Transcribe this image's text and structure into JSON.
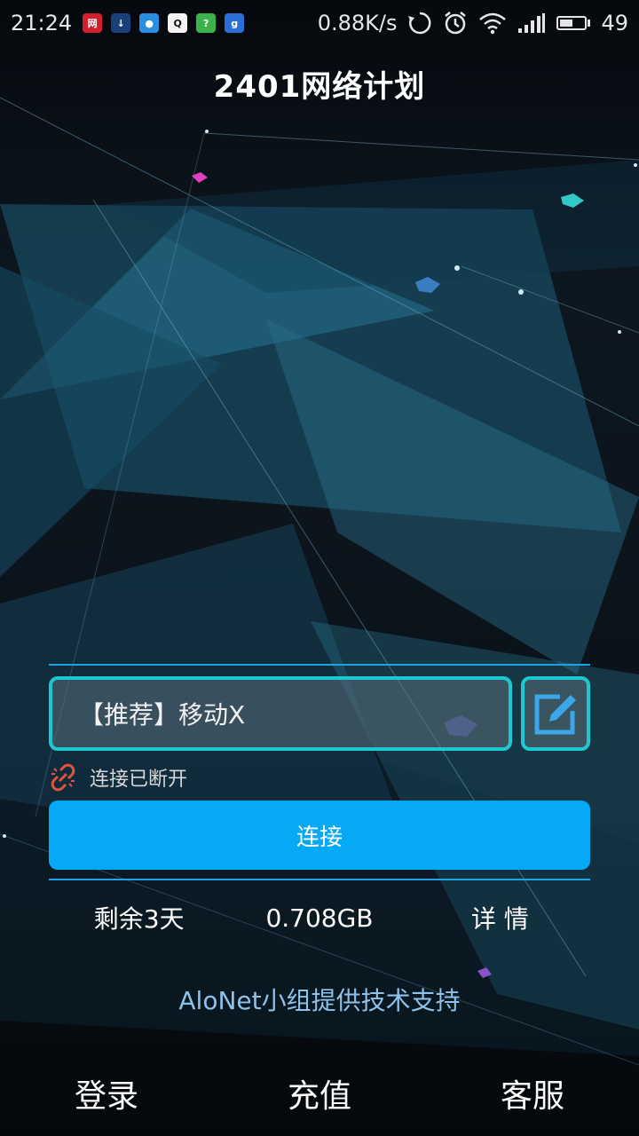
{
  "status_bar": {
    "time": "21:24",
    "net_speed": "0.88K/s",
    "battery_level": "49",
    "notification_icons": [
      {
        "name": "netease-icon",
        "glyph": "网易",
        "color": "#d21f2b"
      },
      {
        "name": "download-icon",
        "glyph": "↓",
        "color": "#1b3f7a"
      },
      {
        "name": "browser-icon",
        "glyph": "●",
        "color": "#2a8ee0"
      },
      {
        "name": "qq-icon",
        "glyph": "Q",
        "color": "#f4f4f4"
      },
      {
        "name": "help-icon",
        "glyph": "?",
        "color": "#3bb34a"
      },
      {
        "name": "g-icon",
        "glyph": "g",
        "color": "#2b6fd6"
      }
    ]
  },
  "app": {
    "title": "2401网络计划"
  },
  "server": {
    "selected": "【推荐】移动X"
  },
  "connection": {
    "status_text": "连接已断开",
    "connect_label": "连接"
  },
  "stats": {
    "remaining": "剩余3天",
    "traffic": "0.708GB",
    "details": "详 情"
  },
  "footer": {
    "support": "AloNet小组提供技术支持"
  },
  "bottom_nav": {
    "login": "登录",
    "recharge": "充值",
    "service": "客服"
  },
  "colors": {
    "accent": "#05a9f5",
    "border": "#1ec8d2",
    "disconnected": "#e0543a"
  }
}
